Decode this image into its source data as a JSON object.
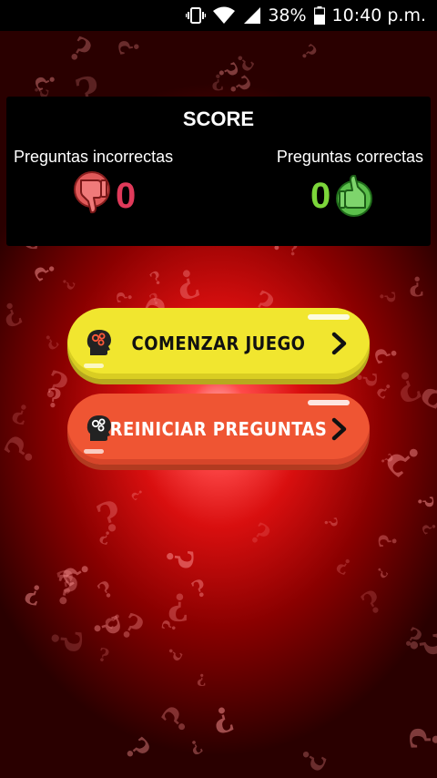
{
  "status_bar": {
    "battery": "38%",
    "time": "10:40 p.m.",
    "icons": [
      "vibrate-icon",
      "wifi-icon",
      "signal-icon",
      "battery-icon"
    ]
  },
  "score": {
    "title": "SCORE",
    "incorrect_label": "Preguntas incorrectas",
    "correct_label": "Preguntas correctas",
    "incorrect_count": "0",
    "correct_count": "0",
    "incorrect_icon": "thumbs-down-icon",
    "correct_icon": "thumbs-up-icon"
  },
  "buttons": {
    "start_label": "COMENZAR JUEGO",
    "reset_label": "REINICIAR PREGUNTAS",
    "head_icon": "brain-head-icon",
    "arrow_icon": "chevron-right-icon"
  },
  "colors": {
    "start_button": "#f1e62f",
    "reset_button": "#ef5533",
    "incorrect_count": "#e03a5a",
    "correct_count": "#7cd63a"
  }
}
